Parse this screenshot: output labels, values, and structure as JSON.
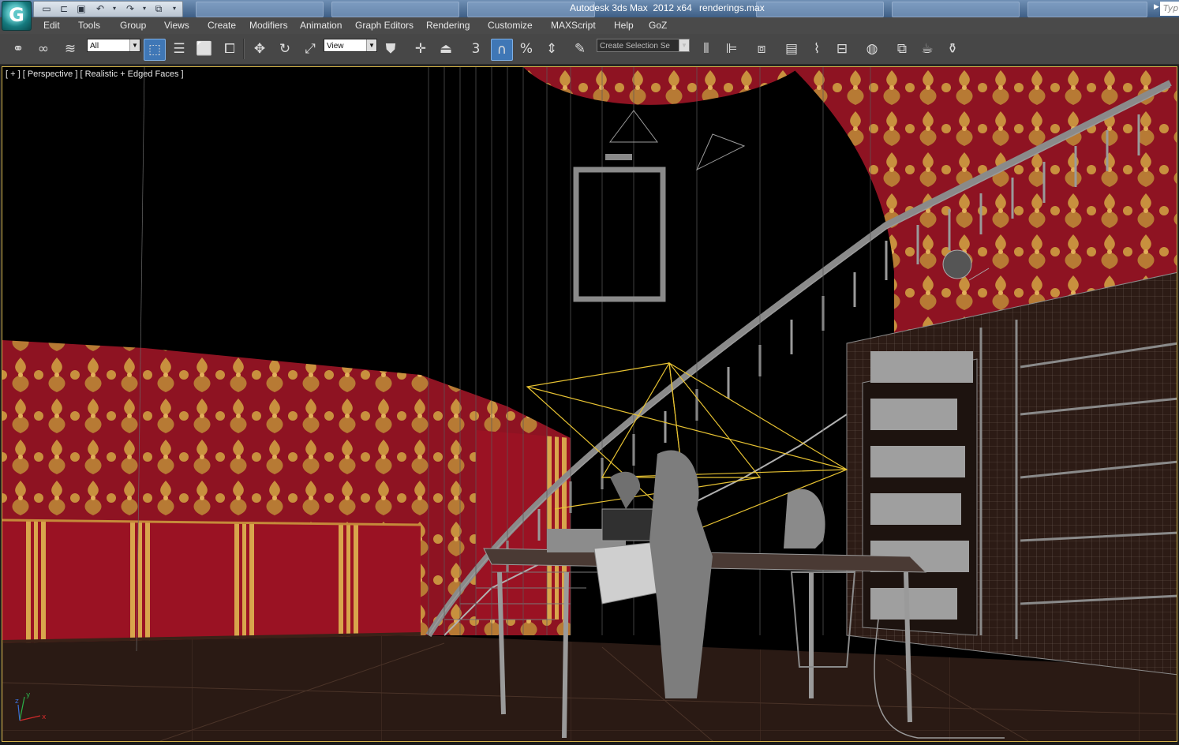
{
  "app": {
    "title": "Autodesk 3ds Max  2012 x64",
    "document": "renderings.max",
    "search_placeholder": "Typ"
  },
  "menu": [
    "Edit",
    "Tools",
    "Group",
    "Views",
    "Create",
    "Modifiers",
    "Animation",
    "Graph Editors",
    "Rendering",
    "Customize",
    "MAXScript",
    "Help",
    "GoZ"
  ],
  "toolbar": {
    "selection_filter": "All",
    "reference_coord": "View",
    "named_selection_placeholder": "Create Selection Se",
    "snap_label": "3",
    "percent_snap_label": "%"
  },
  "viewport": {
    "label": "[ + ] [ Perspective ] [ Realistic + Edged Faces ]",
    "axis_x": "x",
    "axis_y": "y",
    "axis_z": "z"
  },
  "colors": {
    "wallpaper_red": "#8e1322",
    "wallpaper_gold": "#c8903e",
    "floor": "#2a1a14",
    "wireframe": "#b9b9b9",
    "selected_light": "#e7c232",
    "active_tool": "#3f77b6"
  }
}
